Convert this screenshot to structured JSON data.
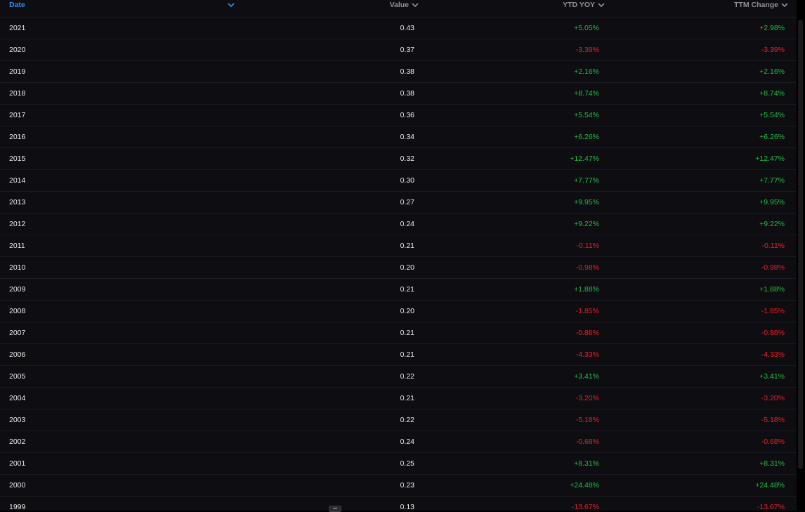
{
  "colors": {
    "background": "#0e0e12",
    "header_text": "#8f9299",
    "sorted_header": "#2d8cf0",
    "positive": "#1fbf45",
    "negative": "#e8202a",
    "text": "#ececec"
  },
  "table": {
    "columns": {
      "date": "Date",
      "value": "Value",
      "ytd_yoy": "YTD YOY",
      "ttm_change": "TTM Change"
    },
    "sort_column": "date",
    "rows": [
      {
        "date": "2021",
        "value": "0.43",
        "ytd": "+5.05%",
        "ttm": "+2.98%"
      },
      {
        "date": "2020",
        "value": "0.37",
        "ytd": "-3.39%",
        "ttm": "-3.39%"
      },
      {
        "date": "2019",
        "value": "0.38",
        "ytd": "+2.16%",
        "ttm": "+2.16%"
      },
      {
        "date": "2018",
        "value": "0.38",
        "ytd": "+8.74%",
        "ttm": "+8.74%"
      },
      {
        "date": "2017",
        "value": "0.36",
        "ytd": "+5.54%",
        "ttm": "+5.54%"
      },
      {
        "date": "2016",
        "value": "0.34",
        "ytd": "+6.26%",
        "ttm": "+6.26%"
      },
      {
        "date": "2015",
        "value": "0.32",
        "ytd": "+12.47%",
        "ttm": "+12.47%"
      },
      {
        "date": "2014",
        "value": "0.30",
        "ytd": "+7.77%",
        "ttm": "+7.77%"
      },
      {
        "date": "2013",
        "value": "0.27",
        "ytd": "+9.95%",
        "ttm": "+9.95%"
      },
      {
        "date": "2012",
        "value": "0.24",
        "ytd": "+9.22%",
        "ttm": "+9.22%"
      },
      {
        "date": "2011",
        "value": "0.21",
        "ytd": "-0.11%",
        "ttm": "-0.11%"
      },
      {
        "date": "2010",
        "value": "0.20",
        "ytd": "-0.98%",
        "ttm": "-0.98%"
      },
      {
        "date": "2009",
        "value": "0.21",
        "ytd": "+1.88%",
        "ttm": "+1.88%"
      },
      {
        "date": "2008",
        "value": "0.20",
        "ytd": "-1.85%",
        "ttm": "-1.85%"
      },
      {
        "date": "2007",
        "value": "0.21",
        "ytd": "-0.86%",
        "ttm": "-0.86%"
      },
      {
        "date": "2006",
        "value": "0.21",
        "ytd": "-4.33%",
        "ttm": "-4.33%"
      },
      {
        "date": "2005",
        "value": "0.22",
        "ytd": "+3.41%",
        "ttm": "+3.41%"
      },
      {
        "date": "2004",
        "value": "0.21",
        "ytd": "-3.20%",
        "ttm": "-3.20%"
      },
      {
        "date": "2003",
        "value": "0.22",
        "ytd": "-5.18%",
        "ttm": "-5.18%"
      },
      {
        "date": "2002",
        "value": "0.24",
        "ytd": "-0.68%",
        "ttm": "-0.68%"
      },
      {
        "date": "2001",
        "value": "0.25",
        "ytd": "+8.31%",
        "ttm": "+8.31%"
      },
      {
        "date": "2000",
        "value": "0.23",
        "ytd": "+24.48%",
        "ttm": "+24.48%"
      },
      {
        "date": "1999",
        "value": "0.13",
        "ytd": "-13.67%",
        "ttm": "-13.67%"
      }
    ]
  }
}
